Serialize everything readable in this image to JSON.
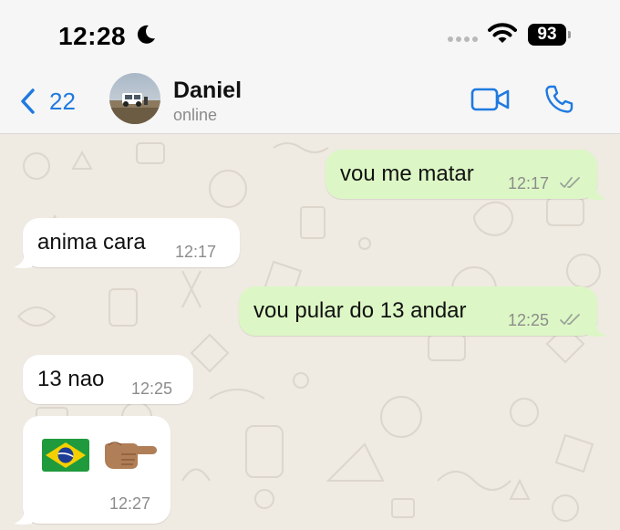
{
  "status_bar": {
    "time": "12:28",
    "battery": "93"
  },
  "header": {
    "back_count": "22",
    "contact_name": "Daniel",
    "contact_status": "online"
  },
  "messages": [
    {
      "direction": "outgoing",
      "text": "vou me matar",
      "time": "12:17",
      "read": true
    },
    {
      "direction": "incoming",
      "text": "anima cara",
      "time": "12:17"
    },
    {
      "direction": "outgoing",
      "text": "vou pular do 13 andar",
      "time": "12:25",
      "read": true
    },
    {
      "direction": "incoming",
      "text": "13 nao",
      "time": "12:25"
    },
    {
      "direction": "incoming",
      "emojis": [
        "flag-brazil-icon",
        "pointing-right-hand-icon"
      ],
      "time": "12:27"
    }
  ],
  "colors": {
    "accent": "#1f7ae0",
    "outgoing_bubble": "#dcf7c5",
    "incoming_bubble": "#ffffff",
    "chat_background": "#efeae2",
    "read_ticks": "#9aa39a"
  }
}
